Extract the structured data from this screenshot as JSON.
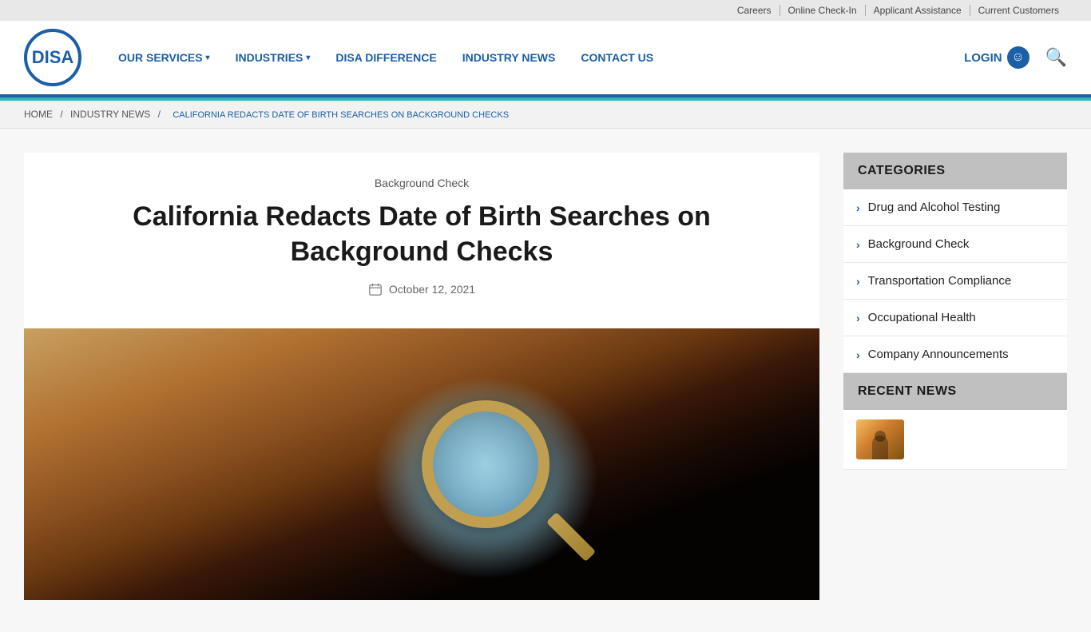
{
  "topbar": {
    "links": [
      "Careers",
      "Online Check-In",
      "Applicant Assistance",
      "Current Customers"
    ]
  },
  "header": {
    "logo_text": "DISA",
    "nav_items": [
      {
        "label": "OUR SERVICES",
        "has_dropdown": true
      },
      {
        "label": "INDUSTRIES",
        "has_dropdown": true
      },
      {
        "label": "DISA DIFFERENCE",
        "has_dropdown": false
      },
      {
        "label": "INDUSTRY NEWS",
        "has_dropdown": false
      },
      {
        "label": "CONTACT US",
        "has_dropdown": false
      }
    ],
    "login_label": "LOGIN",
    "search_label": "Search"
  },
  "breadcrumb": {
    "home": "HOME",
    "news": "INDUSTRY NEWS",
    "current": "CALIFORNIA REDACTS DATE OF BIRTH SEARCHES ON BACKGROUND CHECKS"
  },
  "article": {
    "category": "Background Check",
    "title": "California Redacts Date of Birth Searches on Background Checks",
    "date": "October 12, 2021"
  },
  "sidebar": {
    "categories_header": "CATEGORIES",
    "categories": [
      {
        "label": "Drug and Alcohol Testing"
      },
      {
        "label": "Background Check"
      },
      {
        "label": "Transportation Compliance"
      },
      {
        "label": "Occupational Health"
      },
      {
        "label": "Company Announcements"
      }
    ],
    "recent_header": "RECENT NEWS"
  }
}
